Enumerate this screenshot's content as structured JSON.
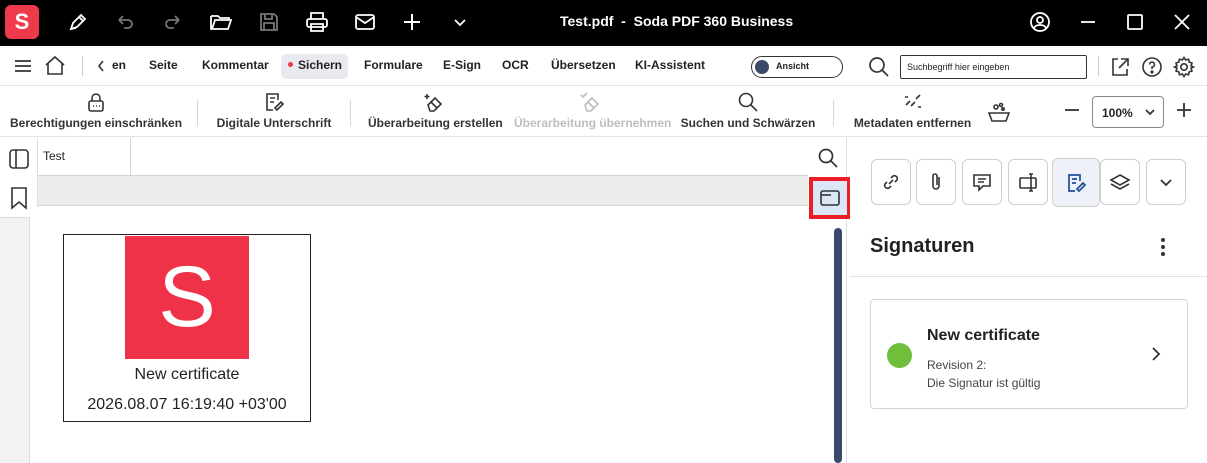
{
  "titlebar": {
    "title": "Test.pdf  -  Soda PDF 360 Business",
    "logo_letter": "S",
    "background": "#000000",
    "brand_color": "#ee3a4a"
  },
  "menubar": {
    "back_label": "en",
    "items": [
      "Seite",
      "Kommentar",
      "Sichern",
      "Formulare",
      "E-Sign",
      "OCR",
      "Übersetzen",
      "KI-Assistent"
    ],
    "active_item": "Sichern",
    "toggle_label": "Ansicht",
    "search_placeholder": "Suchbegriff hier eingeben"
  },
  "ribbon": {
    "items": [
      {
        "label": "Berechtigungen einschränken",
        "icon": "lock-icon",
        "enabled": true
      },
      {
        "label": "Digitale Unterschrift",
        "icon": "signature-icon",
        "enabled": true
      },
      {
        "label": "Überarbeitung erstellen",
        "icon": "eraser-plus-icon",
        "enabled": true
      },
      {
        "label": "Überarbeitung übernehmen",
        "icon": "eraser-check-icon",
        "enabled": false
      },
      {
        "label": "Suchen und Schwärzen",
        "icon": "search-icon",
        "enabled": true
      },
      {
        "label": "Metadaten entfernen",
        "icon": "unlink-icon",
        "enabled": true
      }
    ],
    "zoom": "100%"
  },
  "document": {
    "tab_label": "Test",
    "signature": {
      "logo_letter": "S",
      "name": "New certificate",
      "date": "2026.08.07 16:19:40 +03'00"
    }
  },
  "panel": {
    "title": "Signaturen",
    "certificate": {
      "name": "New certificate",
      "revision": "Revision 2:",
      "status": "Die Signatur ist gültig",
      "status_color": "#6fbf3a"
    }
  },
  "colors": {
    "annotation_red": "#ee1c25",
    "accent_navy": "#3b4a6b"
  }
}
